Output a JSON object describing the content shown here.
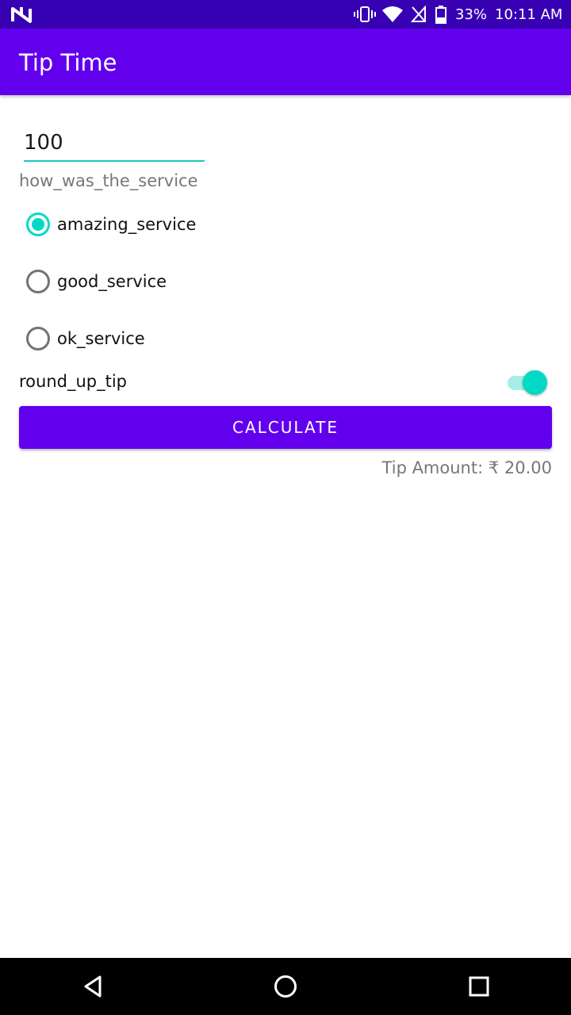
{
  "status_bar": {
    "battery_percent": "33%",
    "time": "10:11 AM",
    "icons": [
      "n-logo-icon",
      "vibrate-icon",
      "wifi-icon",
      "no-signal-icon",
      "battery-icon"
    ]
  },
  "app_bar": {
    "title": "Tip Time"
  },
  "cost_of_service": {
    "value": "100"
  },
  "service_question": "how_was_the_service",
  "service_options": [
    {
      "label": "amazing_service",
      "checked": true
    },
    {
      "label": "good_service",
      "checked": false
    },
    {
      "label": "ok_service",
      "checked": false
    }
  ],
  "round_up": {
    "label": "round_up_tip",
    "enabled": true
  },
  "calculate_button": {
    "label": "CALCULATE"
  },
  "tip_result": "Tip Amount: ₹ 20.00",
  "nav_bar": {
    "icons": [
      "back-icon",
      "home-icon",
      "recents-icon"
    ]
  },
  "colors": {
    "primary": "#6200ee",
    "primary_dark": "#3700b3",
    "accent": "#03dac5"
  }
}
